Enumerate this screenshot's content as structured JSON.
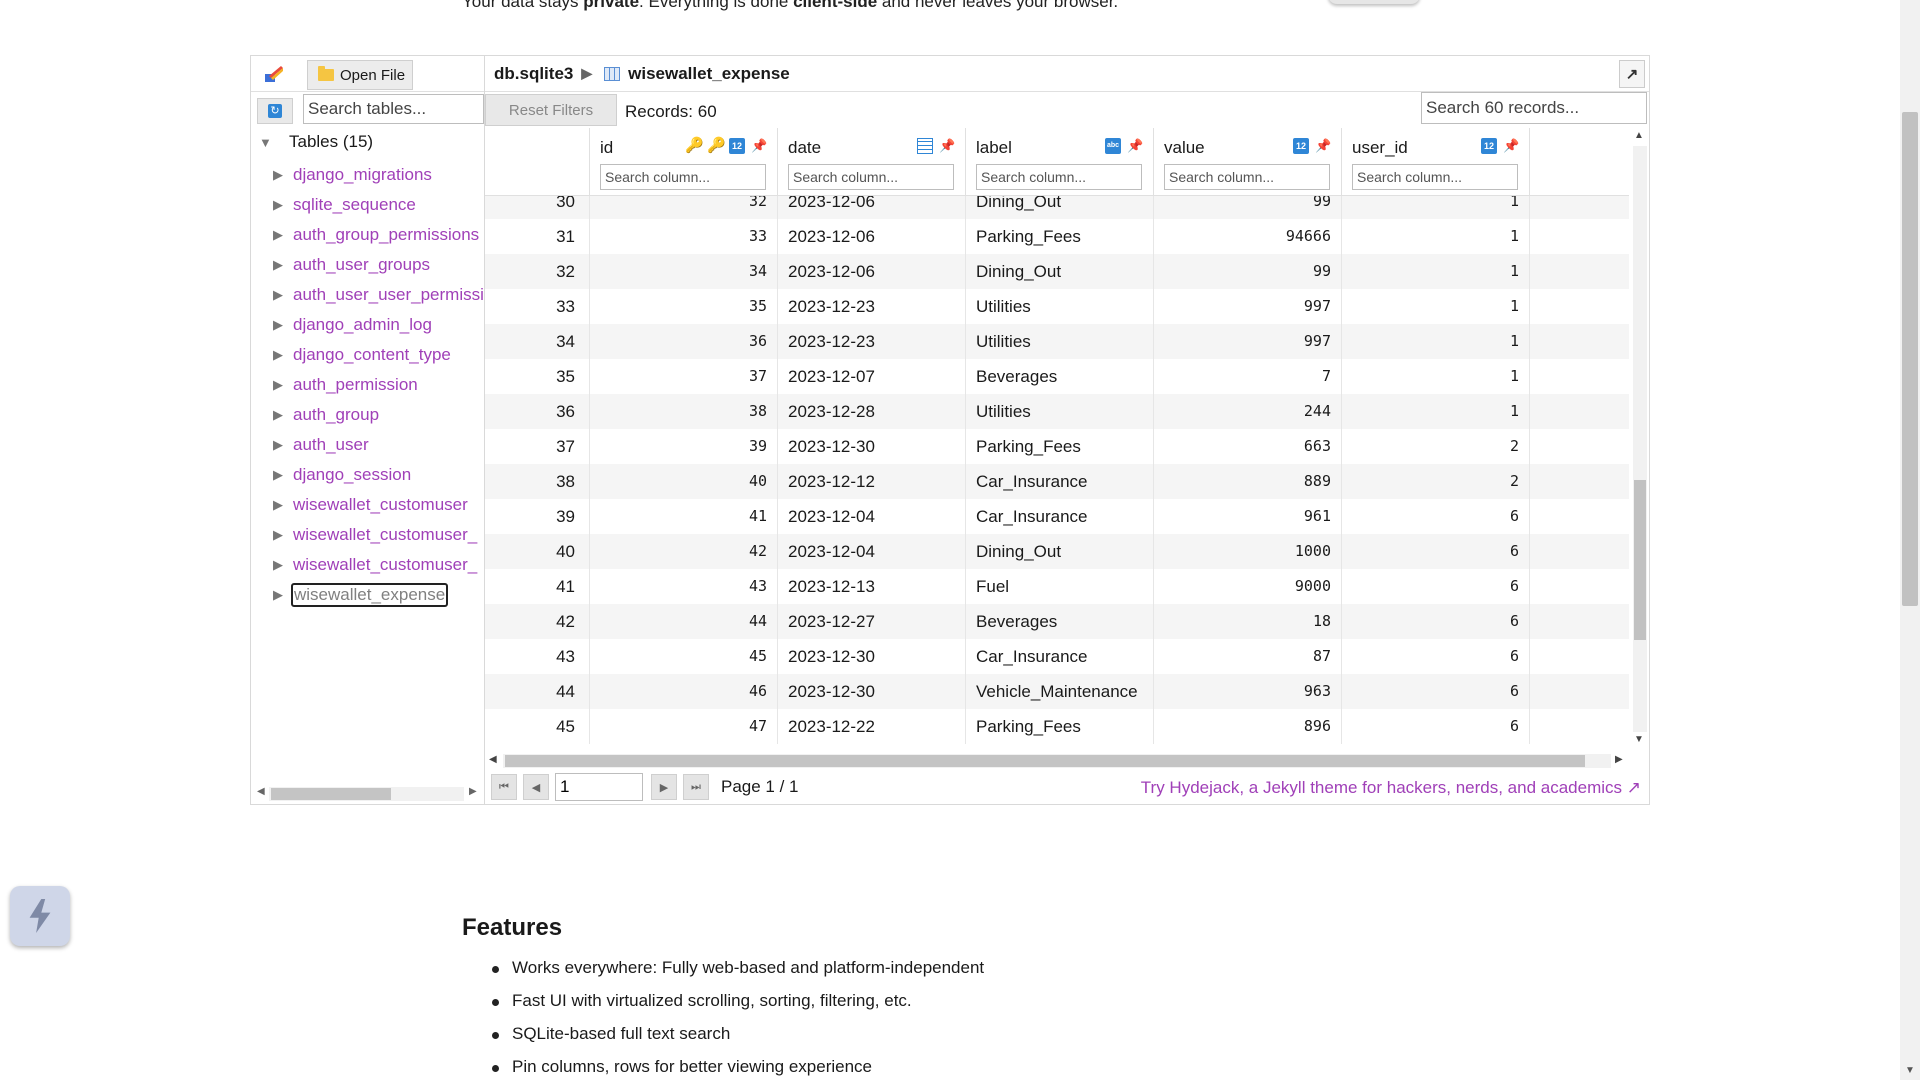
{
  "intro": {
    "prefix": "Your data stays ",
    "bold1": "private",
    "middle": ". Everything is done ",
    "bold2": "client-side",
    "suffix": " and never leaves your browser."
  },
  "sidebar": {
    "open_file_label": "Open File",
    "search_placeholder": "Search tables...",
    "tree_root_label": "Tables (15)",
    "tables": [
      "django_migrations",
      "sqlite_sequence",
      "auth_group_permissions",
      "auth_user_groups",
      "auth_user_user_permissions",
      "django_admin_log",
      "django_content_type",
      "auth_permission",
      "auth_group",
      "auth_user",
      "django_session",
      "wisewallet_customuser",
      "wisewallet_customuser_",
      "wisewallet_customuser_",
      "wisewallet_expense"
    ],
    "selected_table": "wisewallet_expense"
  },
  "breadcrumb": {
    "db": "db.sqlite3",
    "table": "wisewallet_expense"
  },
  "toolbar": {
    "reset_label": "Reset Filters",
    "records_label": "Records: 60",
    "search_placeholder": "Search 60 records..."
  },
  "columns": [
    {
      "name": "id",
      "type": "integer",
      "primary_key": true
    },
    {
      "name": "date",
      "type": "date"
    },
    {
      "name": "label",
      "type": "text"
    },
    {
      "name": "value",
      "type": "integer"
    },
    {
      "name": "user_id",
      "type": "integer"
    }
  ],
  "column_search_placeholder": "Search column...",
  "rows": [
    {
      "rn": "30",
      "id": "32",
      "date": "2023-12-06",
      "label": "Dining_Out",
      "value": "99",
      "user_id": "1"
    },
    {
      "rn": "31",
      "id": "33",
      "date": "2023-12-06",
      "label": "Parking_Fees",
      "value": "94666",
      "user_id": "1"
    },
    {
      "rn": "32",
      "id": "34",
      "date": "2023-12-06",
      "label": "Dining_Out",
      "value": "99",
      "user_id": "1"
    },
    {
      "rn": "33",
      "id": "35",
      "date": "2023-12-23",
      "label": "Utilities",
      "value": "997",
      "user_id": "1"
    },
    {
      "rn": "34",
      "id": "36",
      "date": "2023-12-23",
      "label": "Utilities",
      "value": "997",
      "user_id": "1"
    },
    {
      "rn": "35",
      "id": "37",
      "date": "2023-12-07",
      "label": "Beverages",
      "value": "7",
      "user_id": "1"
    },
    {
      "rn": "36",
      "id": "38",
      "date": "2023-12-28",
      "label": "Utilities",
      "value": "244",
      "user_id": "1"
    },
    {
      "rn": "37",
      "id": "39",
      "date": "2023-12-30",
      "label": "Parking_Fees",
      "value": "663",
      "user_id": "2"
    },
    {
      "rn": "38",
      "id": "40",
      "date": "2023-12-12",
      "label": "Car_Insurance",
      "value": "889",
      "user_id": "2"
    },
    {
      "rn": "39",
      "id": "41",
      "date": "2023-12-04",
      "label": "Car_Insurance",
      "value": "961",
      "user_id": "6"
    },
    {
      "rn": "40",
      "id": "42",
      "date": "2023-12-04",
      "label": "Dining_Out",
      "value": "1000",
      "user_id": "6"
    },
    {
      "rn": "41",
      "id": "43",
      "date": "2023-12-13",
      "label": "Fuel",
      "value": "9000",
      "user_id": "6"
    },
    {
      "rn": "42",
      "id": "44",
      "date": "2023-12-27",
      "label": "Beverages",
      "value": "18",
      "user_id": "6"
    },
    {
      "rn": "43",
      "id": "45",
      "date": "2023-12-30",
      "label": "Car_Insurance",
      "value": "87",
      "user_id": "6"
    },
    {
      "rn": "44",
      "id": "46",
      "date": "2023-12-30",
      "label": "Vehicle_Maintenance",
      "value": "963",
      "user_id": "6"
    },
    {
      "rn": "45",
      "id": "47",
      "date": "2023-12-22",
      "label": "Parking_Fees",
      "value": "896",
      "user_id": "6"
    }
  ],
  "pager": {
    "page_value": "1",
    "page_label": "Page 1 / 1",
    "promo": "Try Hydejack, a Jekyll theme for hackers, nerds, and academics ↗"
  },
  "features": {
    "heading": "Features",
    "items": [
      "Works everywhere: Fully web-based and platform-independent",
      "Fast UI with virtualized scrolling, sorting, filtering, etc.",
      "SQLite-based full text search",
      "Pin columns, rows for better viewing experience"
    ]
  },
  "colors": {
    "link_purple": "#a040b8",
    "pin_red": "#e0213a",
    "type_blue": "#2f86d6",
    "key_gold": "#e0a020"
  }
}
